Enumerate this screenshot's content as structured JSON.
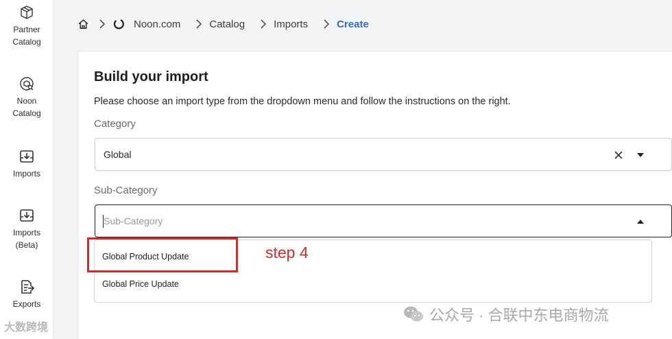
{
  "sidebar": {
    "items": [
      {
        "label": "Partner\nCatalog",
        "icon": "box-icon"
      },
      {
        "label": "Noon\nCatalog",
        "icon": "package-search-icon"
      },
      {
        "label": "Imports",
        "icon": "tray-download-icon"
      },
      {
        "label": "Imports\n(Beta)",
        "icon": "tray-download-icon"
      },
      {
        "label": "Exports",
        "icon": "document-export-icon"
      }
    ]
  },
  "breadcrumb": {
    "items": [
      "Noon.com",
      "Catalog",
      "Imports",
      "Create"
    ]
  },
  "form": {
    "title": "Build your import",
    "description": "Please choose an import type from the dropdown menu and follow the instructions on the right.",
    "category_label": "Category",
    "category_value": "Global",
    "subcategory_label": "Sub-Category",
    "subcategory_placeholder": "Sub-Category",
    "options": [
      "Global Product Update",
      "Global Price Update"
    ]
  },
  "annotation": {
    "text": "step 4",
    "color": "#d32a2a"
  },
  "watermark": {
    "left": "大数跨境",
    "right": "公众号 · 合联中东电商物流"
  },
  "colors": {
    "accent": "#3468c2",
    "annotation": "#d32a2a"
  }
}
